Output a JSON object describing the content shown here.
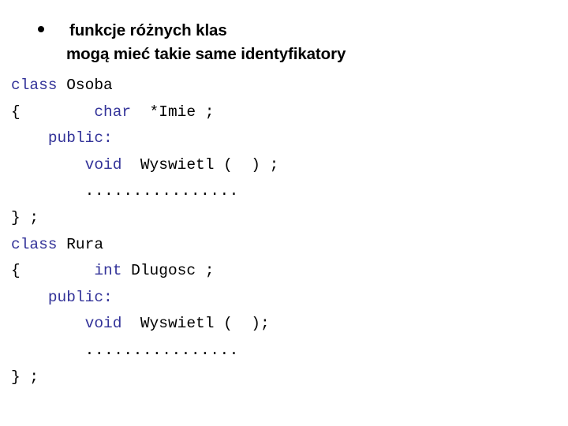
{
  "slide": {
    "background_color": "#ffffff",
    "heading": {
      "bullet_glyph": "•",
      "lines": [
        "funkcje różnych klas",
        "mogą mieć takie same identyfikatory"
      ],
      "text_color": "#000000"
    },
    "code": {
      "keyword_color": "#333399",
      "identifier_color": "#000000",
      "lines": [
        {
          "indent": "",
          "keyword": "class",
          "rest": " Osoba"
        },
        {
          "indent": "",
          "brace": "{",
          "gap": "        ",
          "keyword": "char",
          "rest": "  *Imie ;"
        },
        {
          "indent": "    ",
          "keyword": "public:",
          "rest": ""
        },
        {
          "indent": "        ",
          "keyword": "void",
          "rest": "  Wyswietl (  ) ;"
        },
        {
          "indent": "        ",
          "dots": "................"
        },
        {
          "indent": "",
          "plain": "} ;"
        },
        {
          "indent": "",
          "keyword": "class",
          "rest": " Rura"
        },
        {
          "indent": "",
          "brace": "{",
          "gap": "        ",
          "keyword": "int",
          "rest": " Dlugosc ;"
        },
        {
          "indent": "    ",
          "keyword": "public:",
          "rest": ""
        },
        {
          "indent": "        ",
          "keyword": "void",
          "rest": "  Wyswietl (  );"
        },
        {
          "indent": "        ",
          "dots": "................"
        },
        {
          "indent": "",
          "plain": "} ;"
        }
      ]
    }
  }
}
